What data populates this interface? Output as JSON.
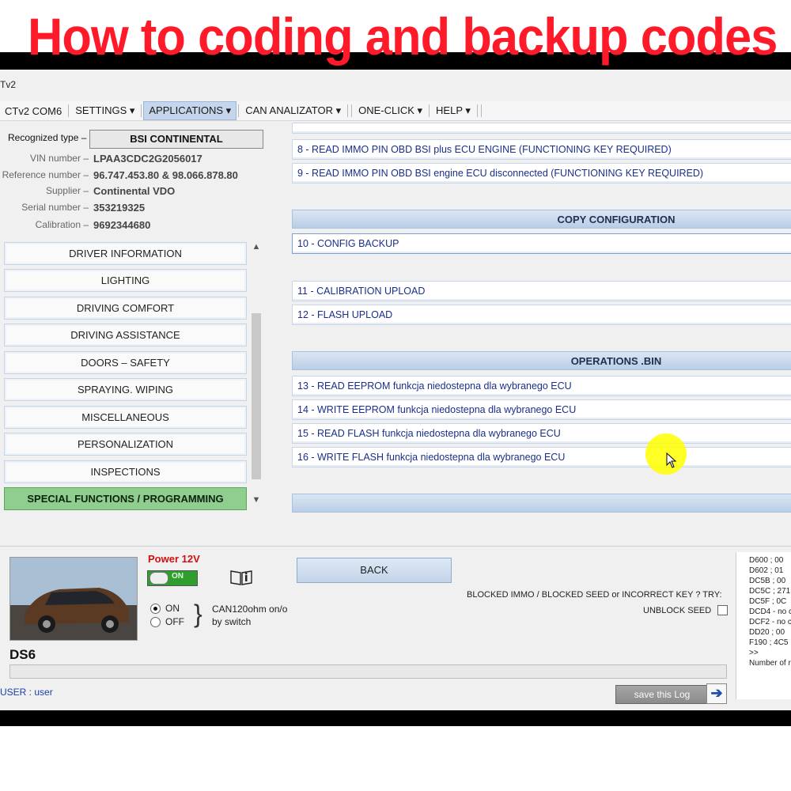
{
  "banner": {
    "title": "How to coding and backup codes"
  },
  "window": {
    "title": "Tv2"
  },
  "menu": {
    "items": [
      {
        "label": "CTv2 COM6"
      },
      {
        "label": "SETTINGS ▾"
      },
      {
        "label": "APPLICATIONS ▾"
      },
      {
        "label": "CAN ANALIZATOR ▾"
      },
      {
        "label": "ONE-CLICK ▾"
      },
      {
        "label": "HELP ▾"
      }
    ]
  },
  "vehicle_info": {
    "recognized_type_label": "Recognized type –",
    "recognized_type": "BSI CONTINENTAL",
    "rows": [
      {
        "label": "VIN number –",
        "value": "LPAA3CDC2G2056017"
      },
      {
        "label": "Reference number –",
        "value": "96.747.453.80 & 98.066.878.80"
      },
      {
        "label": "Supplier –",
        "value": "Continental  VDO"
      },
      {
        "label": "Serial number –",
        "value": "353219325"
      },
      {
        "label": "Calibration –",
        "value": "9692344680"
      }
    ]
  },
  "categories": [
    "DRIVER INFORMATION",
    "LIGHTING",
    "DRIVING COMFORT",
    "DRIVING ASSISTANCE",
    "DOORS – SAFETY",
    "SPRAYING. WIPING",
    "MISCELLANEOUS",
    "PERSONALIZATION",
    "INSPECTIONS",
    "SPECIAL FUNCTIONS / PROGRAMMING"
  ],
  "operations": {
    "immo": [
      "8  - READ IMMO PIN OBD BSI plus ECU ENGINE (FUNCTIONING KEY REQUIRED)",
      "9  - READ IMMO PIN OBD BSI engine ECU disconnected (FUNCTIONING KEY REQUIRED)"
    ],
    "copy_header": "COPY CONFIGURATION",
    "copy": [
      "10  -  CONFIG BACKUP",
      "11  - CALIBRATION UPLOAD",
      "12  - FLASH UPLOAD"
    ],
    "bin_header": "OPERATIONS .BIN",
    "bin": [
      "13  - READ EEPROM  funkcja niedostepna dla wybranego ECU",
      "14  - WRITE EEPROM  funkcja niedostepna dla wybranego ECU",
      "15  - READ FLASH  funkcja niedostepna dla wybranego ECU",
      "16  - WRITE FLASH  funkcja niedostepna dla wybranego ECU"
    ]
  },
  "bottom": {
    "model": "DS6",
    "power_label": "Power 12V",
    "toggle_label": "ON",
    "radio_on": "ON",
    "radio_off": "OFF",
    "can_text_1": "CAN120ohm on/o",
    "can_text_2": "by switch",
    "back_label": "BACK",
    "blocked_text": "BLOCKED IMMO / BLOCKED SEED or INCORRECT KEY ? TRY:",
    "unblock_label": "UNBLOCK SEED",
    "user_label": "USER :  user",
    "save_log": "save this Log",
    "log_lines": [
      "D600 ; 00",
      "D602 ; 01",
      "DC5B ; 00",
      "DC5C ; 271",
      "DC5F ; 0C",
      "DCD4 - no c",
      "DCF2 - no c",
      "DD20 ; 00",
      "F190 ; 4C5",
      ">>",
      "Number of r"
    ]
  },
  "colors": {
    "banner_red": "#ff1a2a",
    "special_green": "#8fce8f",
    "link_blue": "#1a2f8a"
  }
}
